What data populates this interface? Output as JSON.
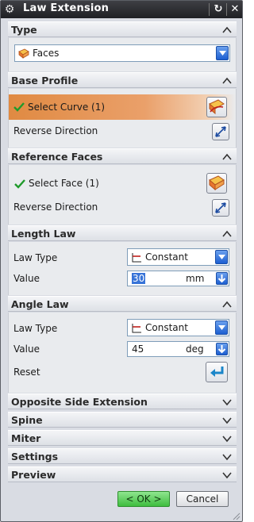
{
  "window": {
    "title": "Law Extension"
  },
  "sections": {
    "type": {
      "title": "Type",
      "dropdown": "Faces"
    },
    "base_profile": {
      "title": "Base Profile",
      "select_label": "Select Curve (1)",
      "reverse_label": "Reverse Direction"
    },
    "reference_faces": {
      "title": "Reference Faces",
      "select_label": "Select Face (1)",
      "reverse_label": "Reverse Direction"
    },
    "length_law": {
      "title": "Length Law",
      "law_type_label": "Law Type",
      "law_type_value": "Constant",
      "value_label": "Value",
      "value": "30",
      "unit": "mm"
    },
    "angle_law": {
      "title": "Angle Law",
      "law_type_label": "Law Type",
      "law_type_value": "Constant",
      "value_label": "Value",
      "value": "45",
      "unit": "deg",
      "reset_label": "Reset"
    },
    "collapsed": [
      "Opposite Side Extension",
      "Spine",
      "Miter",
      "Settings",
      "Preview"
    ]
  },
  "buttons": {
    "ok": "< OK >",
    "cancel": "Cancel"
  },
  "colors": {
    "accent_select": "#e08a42",
    "ok_green": "#3fbd3f",
    "combo_blue": "#1d5fd1"
  }
}
